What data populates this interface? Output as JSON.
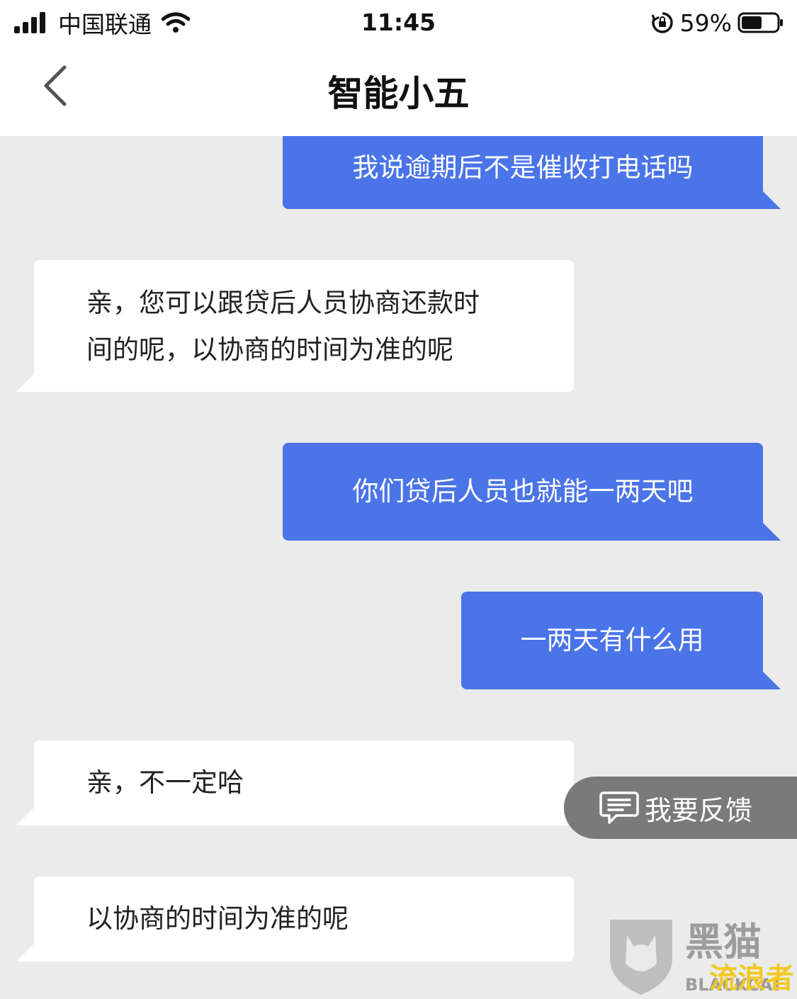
{
  "status_bar": {
    "carrier": "中国联通",
    "time": "11:45",
    "battery_percent": "59%",
    "battery_level": 0.59,
    "icons": [
      "signal-bars-icon",
      "wifi-icon",
      "rotation-lock-icon",
      "battery-icon"
    ]
  },
  "nav": {
    "title": "智能小五",
    "back_icon": "chevron-left-icon"
  },
  "messages": [
    {
      "sender": "user",
      "text": "我说逾期后不是催收打电话吗"
    },
    {
      "sender": "bot",
      "lines": [
        "亲，您可以跟贷后人员协商还款时",
        "间的呢，以协商的时间为准的呢"
      ]
    },
    {
      "sender": "user",
      "text": "你们贷后人员也就能一两天吧"
    },
    {
      "sender": "user",
      "text": "一两天有什么用"
    },
    {
      "sender": "bot",
      "lines": [
        "亲，不一定哈"
      ]
    },
    {
      "sender": "bot",
      "lines": [
        "以协商的时间为准的呢"
      ]
    }
  ],
  "feedback_button": {
    "label": "我要反馈",
    "icon": "message-square-icon"
  },
  "watermark": {
    "brand": "黑猫",
    "brand_latin": "BLACKCAT",
    "overlay": "流浪者",
    "icon": "cat-shield-logo-icon"
  },
  "colors": {
    "user_bubble": "#4a74e8",
    "bot_bubble": "#ffffff",
    "chat_background": "#ebebeb",
    "feedback_button": "#7a7a7a"
  }
}
